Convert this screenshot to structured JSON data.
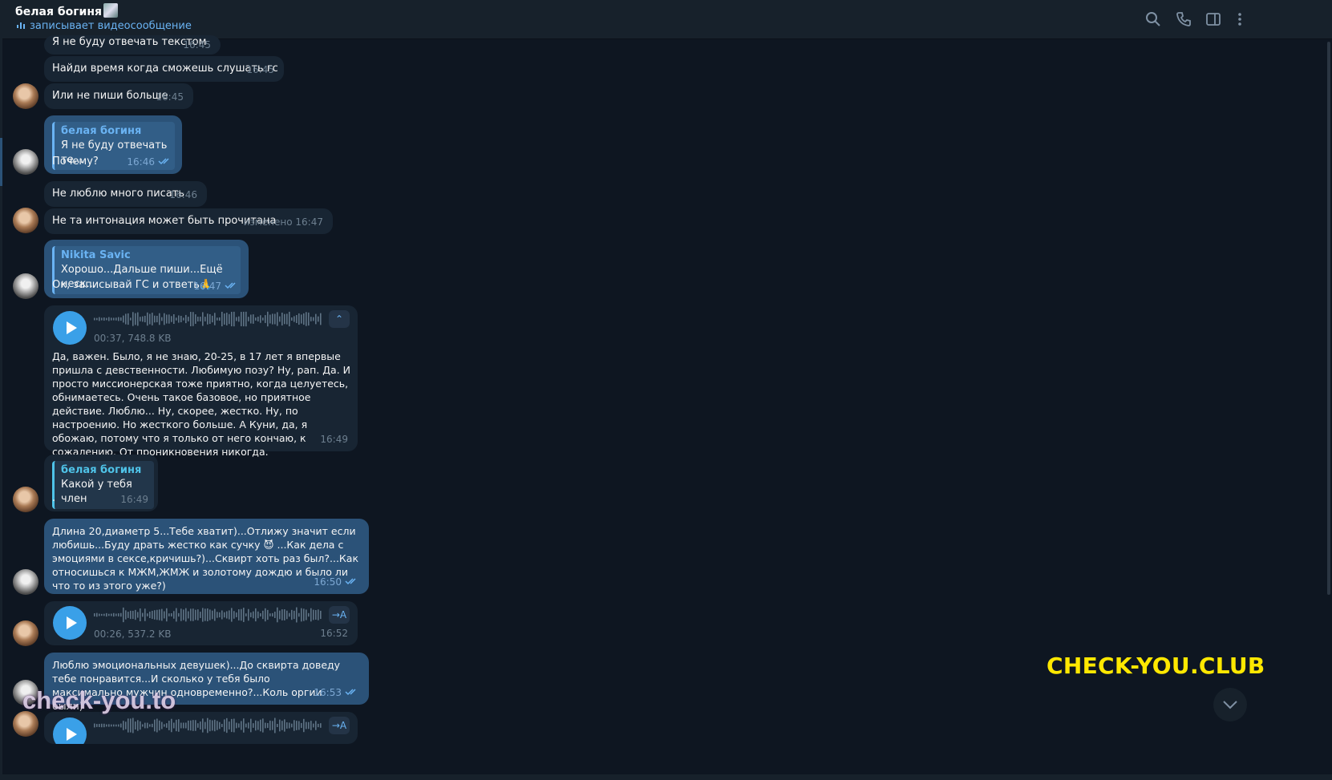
{
  "header": {
    "title": "белая богиня",
    "status": "записывает видеосообщение",
    "icons": [
      "search-icon",
      "phone-icon",
      "sidebar-icon",
      "more-icon"
    ]
  },
  "messages": [
    {
      "text": "Я не буду отвечать текстом",
      "time": "16:45"
    },
    {
      "text": "Найди время когда сможешь слушать гс",
      "time": "16:45"
    },
    {
      "text": "Или не пиши больше",
      "time": "16:45"
    },
    {
      "reply_name": "белая богиня",
      "reply_text": "Я не буду отвечать те...",
      "text": "Почему?",
      "time": "16:46"
    },
    {
      "text": "Не люблю много писать",
      "time": "16:46"
    },
    {
      "text": "Не та интонация может быть прочитана",
      "time": "изменено 16:47"
    },
    {
      "reply_name": "Nikita Savic",
      "reply_text": "Хорошо...Дальше пиши...Ещё неск...",
      "text": "Ок, записывай ГС и ответь🙏",
      "time": "16:47"
    },
    {
      "voice_meta": "00:37, 748.8 KB",
      "text": "Да, важен. Было, я не знаю, 20-25, в 17 лет я впервые пришла с девственности. Любимую позу? Ну, рап. Да. И просто миссионерская тоже приятно, когда целуетесь, обнимаетесь. Очень такое базовое, но приятное действие. Люблю... Ну, скорее, жестко. Ну, по настроению. Но жесткого больше. А Куни, да, я обожаю, потому что я только от него кончаю, к сожалению. От проникновения никогда.",
      "time": "16:49"
    },
    {
      "reply_name": "белая богиня",
      "reply_text": "Какой у тебя член",
      "text": ".",
      "time": "16:49"
    },
    {
      "text": "Длина 20,диаметр 5...Тебе хватит)...Отлижу значит если любишь...Буду драть жестко как сучку 😈 ...Как дела с эмоциями в сексе,кричишь?)...Сквирт хоть раз был?...Как относишься к МЖМ,ЖМЖ и золотому дождю и было ли что то из этого уже?)",
      "time": "16:50"
    },
    {
      "voice_meta": "00:26, 537.2 KB",
      "time": "16:52"
    },
    {
      "text": "Люблю эмоциональных девушек)...До сквирта доведу тебе понравится...И сколько у тебя было максимально мужчин одновременно?...Коль оргии были)",
      "time": "16:53"
    }
  ],
  "watermarks": {
    "club": "CHECK-YOU.CLUB",
    "to": "check-you.to"
  },
  "colors": {
    "bg": "#0e1621",
    "incoming": "#182533",
    "outgoing": "#2b5278",
    "accent": "#6ab3f3",
    "watermark": "#ffe800"
  }
}
